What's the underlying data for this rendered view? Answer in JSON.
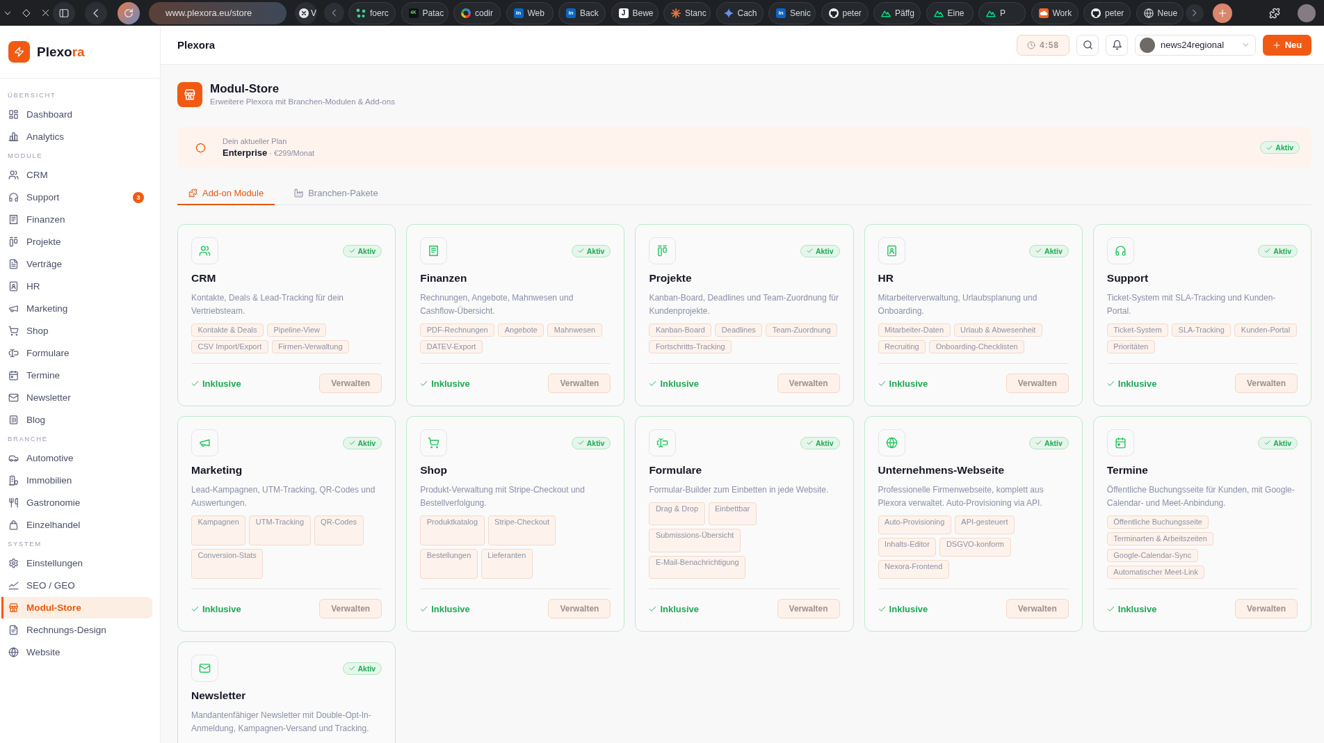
{
  "browser": {
    "url": "www.plexora.eu/store",
    "tabs": [
      {
        "label": "V",
        "selected": true
      },
      {
        "label": "foerc",
        "selected": false
      },
      {
        "label": "Patac",
        "selected": false,
        "favicon_text": "4K"
      },
      {
        "label": "codir",
        "selected": false
      },
      {
        "label": "Web",
        "selected": false,
        "favicon_text": "in"
      },
      {
        "label": "Back",
        "selected": false,
        "favicon_text": "in"
      },
      {
        "label": "Bewe",
        "selected": false,
        "favicon_text": "J"
      },
      {
        "label": "Stanc",
        "selected": false
      },
      {
        "label": "Cach",
        "selected": false
      },
      {
        "label": "Senic",
        "selected": false,
        "favicon_text": "in"
      },
      {
        "label": "peter",
        "selected": false
      },
      {
        "label": "Päffg",
        "selected": false
      },
      {
        "label": "Eine",
        "selected": false
      },
      {
        "label": "P",
        "selected": false
      },
      {
        "label": "Work",
        "selected": false
      },
      {
        "label": "peter",
        "selected": false
      },
      {
        "label": "Neue",
        "selected": false
      }
    ]
  },
  "sidebar": {
    "logo": [
      {
        "text": "Plexo",
        "accent": false
      },
      {
        "text": "ra",
        "accent": true
      }
    ],
    "sections": [
      {
        "title": "ÜBERSICHT",
        "items": [
          {
            "label": "Dashboard",
            "selected": false
          },
          {
            "label": "Analytics",
            "selected": false
          }
        ]
      },
      {
        "title": "MODULE",
        "items": [
          {
            "label": "CRM",
            "selected": false
          },
          {
            "label": "Support",
            "selected": false,
            "badge": "3"
          },
          {
            "label": "Finanzen",
            "selected": false
          },
          {
            "label": "Projekte",
            "selected": false
          },
          {
            "label": "Verträge",
            "selected": false
          },
          {
            "label": "HR",
            "selected": false
          },
          {
            "label": "Marketing",
            "selected": false
          },
          {
            "label": "Shop",
            "selected": false
          },
          {
            "label": "Formulare",
            "selected": false
          },
          {
            "label": "Termine",
            "selected": false
          },
          {
            "label": "Newsletter",
            "selected": false
          },
          {
            "label": "Blog",
            "selected": false
          }
        ]
      },
      {
        "title": "BRANCHE",
        "items": [
          {
            "label": "Automotive",
            "selected": false
          },
          {
            "label": "Immobilien",
            "selected": false
          },
          {
            "label": "Gastronomie",
            "selected": false
          },
          {
            "label": "Einzelhandel",
            "selected": false
          }
        ]
      },
      {
        "title": "SYSTEM",
        "items": [
          {
            "label": "Einstellungen",
            "selected": false
          },
          {
            "label": "SEO / GEO",
            "selected": false
          },
          {
            "label": "Modul-Store",
            "selected": true
          },
          {
            "label": "Rechnungs-Design",
            "selected": false
          },
          {
            "label": "Website",
            "selected": false
          }
        ]
      }
    ]
  },
  "header": {
    "title": "Plexora",
    "timer": "4:58",
    "user": "news24regional",
    "new_button": "Neu"
  },
  "page": {
    "title": "Modul-Store",
    "subtitle": "Erweitere Plexora mit Branchen-Modulen & Add-ons"
  },
  "plan": {
    "label": "Dein aktueller Plan",
    "name": "Enterprise",
    "price": "· €299/Monat",
    "status": "Aktiv"
  },
  "tabs": [
    {
      "label": "Add-on Module",
      "selected": true
    },
    {
      "label": "Branchen-Pakete",
      "selected": false
    }
  ],
  "modules": [
    {
      "name": "CRM",
      "status": "Aktiv",
      "active": true,
      "description": "Kontakte, Deals & Lead-Tracking für dein Vertriebsteam.",
      "tags": [
        "Kontakte & Deals",
        "Pipeline-View",
        "CSV Import/Export",
        "Firmen-Verwaltung"
      ],
      "included": "Inklusive",
      "action": "Verwalten"
    },
    {
      "name": "Finanzen",
      "status": "Aktiv",
      "active": true,
      "description": "Rechnungen, Angebote, Mahnwesen und Cashflow-Übersicht.",
      "tags": [
        "PDF-Rechnungen",
        "Angebote",
        "Mahnwesen",
        "DATEV-Export"
      ],
      "included": "Inklusive",
      "action": "Verwalten"
    },
    {
      "name": "Projekte",
      "status": "Aktiv",
      "active": true,
      "description": "Kanban-Board, Deadlines und Team-Zuordnung für Kundenprojekte.",
      "tags": [
        "Kanban-Board",
        "Deadlines",
        "Team-Zuordnung",
        "Fortschritts-Tracking"
      ],
      "included": "Inklusive",
      "action": "Verwalten"
    },
    {
      "name": "HR",
      "status": "Aktiv",
      "active": true,
      "description": "Mitarbeiterverwaltung, Urlaubsplanung und Onboarding.",
      "tags": [
        "Mitarbeiter-Daten",
        "Urlaub & Abwesenheit",
        "Recruiting",
        "Onboarding-Checklisten"
      ],
      "included": "Inklusive",
      "action": "Verwalten"
    },
    {
      "name": "Support",
      "status": "Aktiv",
      "active": true,
      "description": "Ticket-System mit SLA-Tracking und Kunden-Portal.",
      "tags": [
        "Ticket-System",
        "SLA-Tracking",
        "Kunden-Portal",
        "Prioritäten"
      ],
      "included": "Inklusive",
      "action": "Verwalten"
    },
    {
      "name": "Marketing",
      "status": "Aktiv",
      "active": true,
      "description": "Lead-Kampagnen, UTM-Tracking, QR-Codes und Auswertungen.",
      "tags": [
        "Kampagnen",
        "UTM-Tracking",
        "QR-Codes",
        "Conversion-Stats"
      ],
      "included": "Inklusive",
      "action": "Verwalten"
    },
    {
      "name": "Shop",
      "status": "Aktiv",
      "active": true,
      "description": "Produkt-Verwaltung mit Stripe-Checkout und Bestellverfolgung.",
      "tags": [
        "Produktkatalog",
        "Stripe-Checkout",
        "Bestellungen",
        "Lieferanten"
      ],
      "included": "Inklusive",
      "action": "Verwalten"
    },
    {
      "name": "Formulare",
      "status": "Aktiv",
      "active": true,
      "description": "Formular-Builder zum Einbetten in jede Website.",
      "tags": [
        "Drag & Drop",
        "Einbettbar",
        "Submissions-Übersicht",
        "E-Mail-Benachrichtigung"
      ],
      "included": "Inklusive",
      "action": "Verwalten"
    },
    {
      "name": "Unternehmens-Webseite",
      "status": "Aktiv",
      "active": true,
      "description": "Professionelle Firmenwebseite, komplett aus Plexora verwaltet. Auto-Provisioning via API.",
      "tags": [
        "Auto-Provisioning",
        "API-gesteuert",
        "Inhalts-Editor",
        "DSGVO-konform",
        "Nexora-Frontend"
      ],
      "included": "Inklusive",
      "action": "Verwalten"
    },
    {
      "name": "Termine",
      "status": "Aktiv",
      "active": true,
      "description": "Öffentliche Buchungsseite für Kunden, mit Google-Calendar- und Meet-Anbindung.",
      "tags": [
        "Öffentliche Buchungsseite",
        "Terminarten & Arbeitszeiten",
        "Google-Calendar-Sync",
        "Automatischer Meet-Link"
      ],
      "included": "Inklusive",
      "action": "Verwalten"
    },
    {
      "name": "Newsletter",
      "status": "Aktiv",
      "active": true,
      "description": "Mandantenfähiger Newsletter mit Double-Opt-In-Anmeldung, Kampagnen-Versand und Tracking."
    }
  ]
}
